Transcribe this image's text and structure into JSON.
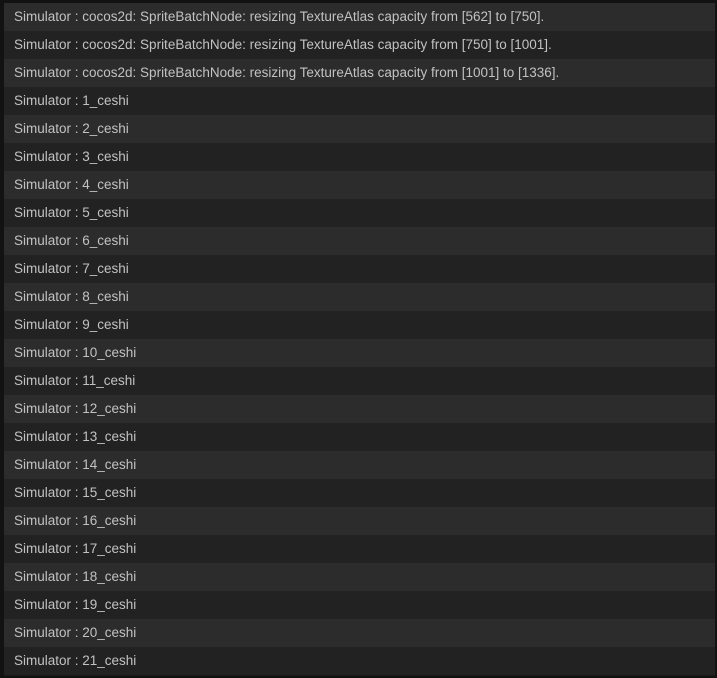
{
  "console": {
    "lines": [
      "Simulator : cocos2d: SpriteBatchNode: resizing TextureAtlas capacity from [562] to [750].",
      "Simulator : cocos2d: SpriteBatchNode: resizing TextureAtlas capacity from [750] to [1001].",
      "Simulator : cocos2d: SpriteBatchNode: resizing TextureAtlas capacity from [1001] to [1336].",
      "Simulator : 1_ceshi",
      "Simulator : 2_ceshi",
      "Simulator : 3_ceshi",
      "Simulator : 4_ceshi",
      "Simulator : 5_ceshi",
      "Simulator : 6_ceshi",
      "Simulator : 7_ceshi",
      "Simulator : 8_ceshi",
      "Simulator : 9_ceshi",
      "Simulator : 10_ceshi",
      "Simulator : 11_ceshi",
      "Simulator : 12_ceshi",
      "Simulator : 13_ceshi",
      "Simulator : 14_ceshi",
      "Simulator : 15_ceshi",
      "Simulator : 16_ceshi",
      "Simulator : 17_ceshi",
      "Simulator : 18_ceshi",
      "Simulator : 19_ceshi",
      "Simulator : 20_ceshi",
      "Simulator : 21_ceshi"
    ]
  }
}
